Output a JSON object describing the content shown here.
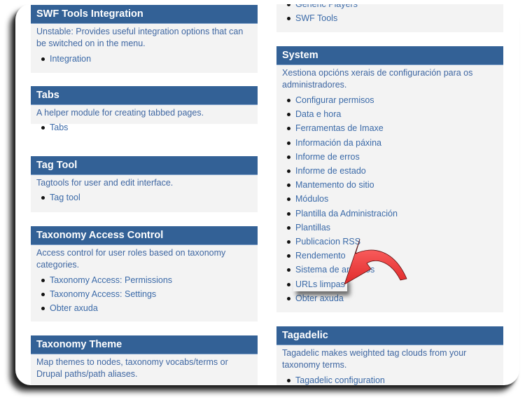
{
  "left_column": [
    {
      "title": "SWF Tools Integration",
      "description": "Unstable: Provides useful integration options that can be switched on in the menu.",
      "links": [
        "Integration"
      ]
    },
    {
      "title": "Tabs",
      "description": "A helper module for creating tabbed pages.",
      "links": [
        "Tabs"
      ]
    },
    {
      "title": "Tag Tool",
      "description": "Tagtools for user and edit interface.",
      "links": [
        "Tag tool"
      ]
    },
    {
      "title": "Taxonomy Access Control",
      "description": "Access control for user roles based on taxonomy categories.",
      "links": [
        "Taxonomy Access: Permissions",
        "Taxonomy Access: Settings",
        "Obter axuda"
      ]
    },
    {
      "title": "Taxonomy Theme",
      "description": "Map themes to nodes, taxonomy vocabs/terms or Drupal paths/path aliases.",
      "links": []
    }
  ],
  "right_column": {
    "partial_block": {
      "links": [
        "Generic Players",
        "SWF Tools"
      ]
    },
    "system": {
      "title": "System",
      "description": "Xestiona opcións xerais de configuración para os administradores.",
      "links": [
        "Configurar permisos",
        "Data e hora",
        "Ferramentas de Imaxe",
        "Información da páxina",
        "Informe de erros",
        "Informe de estado",
        "Mantemento do sitio",
        "Módulos",
        "Plantilla da Administración",
        "Plantillas",
        "Publicacion RSS",
        "Rendemento",
        "Sistema de arquivos",
        "URLs limpas",
        "Obter axuda"
      ],
      "highlighted_link": "URLs limpas"
    },
    "tagadelic": {
      "title": "Tagadelic",
      "description": "Tagadelic makes weighted tag clouds from your taxonomy terms.",
      "links": [
        "Tagadelic configuration"
      ]
    }
  },
  "annotation": {
    "icon": "curved-arrow-icon",
    "color": "#ee3333"
  },
  "colors": {
    "header_bg": "#336196",
    "block_bg": "#f3f3f3",
    "link": "#3b6aa8"
  }
}
